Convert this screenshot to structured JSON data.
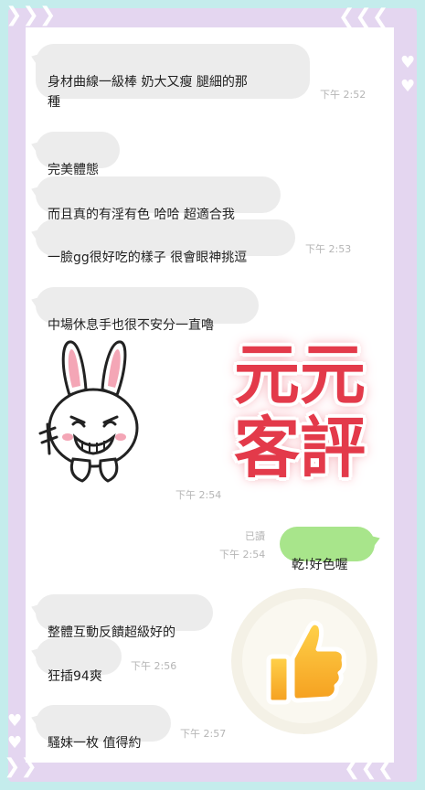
{
  "messages": [
    {
      "text": "身材曲線一級棒 奶大又瘦 腿細的那\n種",
      "time": "下午 2:52"
    },
    {
      "text": "完美體態"
    },
    {
      "text": "而且真的有淫有色 哈哈 超適合我"
    },
    {
      "text": "一臉gg很好吃的樣子 很會眼神挑逗",
      "time": "下午 2:53"
    },
    {
      "text": "中場休息手也很不安分一直嚕"
    },
    {
      "time": "下午 2:54"
    },
    {
      "text": "整體互動反饋超級好的"
    },
    {
      "text": "狂插94爽",
      "time": "下午 2:56"
    },
    {
      "text": "騷妹一枚 值得約",
      "time": "下午 2:57"
    }
  ],
  "outgoing": {
    "text": "乾!好色喔",
    "read": "已讀",
    "time": "下午 2:54"
  },
  "stamp": {
    "line1": "元元",
    "line2": "客評"
  },
  "icons": {
    "sticker": "rabbit-sticker-icon",
    "thumb": "thumbs-up-icon",
    "arrow": "arrow-decoration-icon",
    "heart": "heart-decoration-icon"
  },
  "colors": {
    "background": "#c4ecec",
    "frame": "#e4d6f0",
    "bubble_in": "#ececec",
    "bubble_out": "#a8e58b",
    "stamp": "#e33a4a"
  }
}
